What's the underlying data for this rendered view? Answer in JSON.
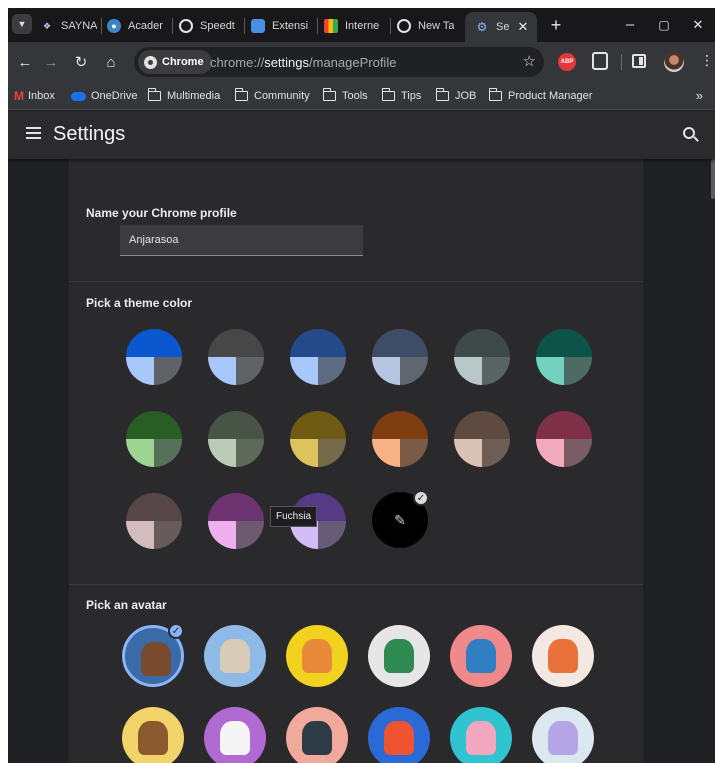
{
  "tabs": [
    {
      "label": "SAYNA",
      "favicon": "sayna-icon",
      "color": "#9aa0ff"
    },
    {
      "label": "Acader",
      "favicon": "academy-icon",
      "color": "#6cc4ff"
    },
    {
      "label": "Speedt",
      "favicon": "speedtest-icon",
      "color": "#e3e3e3"
    },
    {
      "label": "Extensi",
      "favicon": "extensions-icon",
      "color": "#4a90e2"
    },
    {
      "label": "Interne",
      "favicon": "internet-icon",
      "color": "#f2b300"
    },
    {
      "label": "New Ta",
      "favicon": "new-tab-icon",
      "color": "#e3e3e3"
    },
    {
      "label": "Se",
      "favicon": "settings-icon",
      "color": "#8ab4f8",
      "active": true
    }
  ],
  "toolbar": {
    "chip_label": "Chrome",
    "url_prefix": "chrome://",
    "url_host": "settings",
    "url_path": "/manageProfile",
    "abp_label": "ABP"
  },
  "bookmarks": [
    {
      "label": "Inbox",
      "icon": "gmail-icon"
    },
    {
      "label": "OneDrive",
      "icon": "onedrive-icon"
    },
    {
      "label": "Multimedia",
      "icon": "folder-icon"
    },
    {
      "label": "Community",
      "icon": "folder-icon"
    },
    {
      "label": "Tools",
      "icon": "folder-icon"
    },
    {
      "label": "Tips",
      "icon": "folder-icon"
    },
    {
      "label": "JOB",
      "icon": "folder-icon"
    },
    {
      "label": "Product Manager",
      "icon": "folder-icon"
    }
  ],
  "settings": {
    "title": "Settings",
    "name_section_title": "Name your Chrome profile",
    "profile_name": "Anjarasoa",
    "theme_section_title": "Pick a theme color",
    "tooltip": "Fuchsia",
    "avatar_section_title": "Pick an avatar"
  },
  "themes": [
    {
      "top": "#0b57d0",
      "bl": "#a8c7fa",
      "br": "#5f6368"
    },
    {
      "top": "#474747",
      "bl": "#a8c7fa",
      "br": "#5f6368"
    },
    {
      "top": "#254a8a",
      "bl": "#a8c7fa",
      "br": "#5e6a80"
    },
    {
      "top": "#3f4c66",
      "bl": "#b5c4e0",
      "br": "#5f6670"
    },
    {
      "top": "#3e4a4a",
      "bl": "#b8c8c8",
      "br": "#5a6464"
    },
    {
      "top": "#0d5347",
      "bl": "#72d2bf",
      "br": "#4e6a64"
    },
    {
      "top": "#285d23",
      "bl": "#9ed491",
      "br": "#56705a"
    },
    {
      "top": "#485445",
      "bl": "#bccbb7",
      "br": "#5d6a5a"
    },
    {
      "top": "#6e5a12",
      "bl": "#dec35c",
      "br": "#76694a"
    },
    {
      "top": "#7f3d10",
      "bl": "#f8b184",
      "br": "#7a5b47"
    },
    {
      "top": "#5e4a3e",
      "bl": "#dac3b4",
      "br": "#6e5f56"
    },
    {
      "top": "#7e3049",
      "bl": "#f4aabd",
      "br": "#7a5c65"
    },
    {
      "top": "#574647",
      "bl": "#d3bcbd",
      "br": "#675b5c"
    },
    {
      "top": "#6d3270",
      "bl": "#eeb0ee",
      "br": "#6e5a70"
    },
    {
      "top": "#573a86",
      "bl": "#d4bcf6",
      "br": "#665c78"
    }
  ],
  "avatars": [
    {
      "name": "profile-photo-avatar",
      "bg": "#3b6aa8",
      "fg": "#7a4a2e",
      "selected": true
    },
    {
      "name": "origami-cat-avatar",
      "bg": "#8fb9e6",
      "fg": "#d8cbb8"
    },
    {
      "name": "origami-corgi-avatar",
      "bg": "#f2d11f",
      "fg": "#e88a3a"
    },
    {
      "name": "origami-dragon-avatar",
      "bg": "#e6e6e6",
      "fg": "#2f8a52"
    },
    {
      "name": "origami-elephant-avatar",
      "bg": "#f08a8a",
      "fg": "#2f7fc2"
    },
    {
      "name": "origami-fox-avatar",
      "bg": "#f4e8e2",
      "fg": "#e8723a"
    },
    {
      "name": "origami-monkey-avatar",
      "bg": "#f2d46a",
      "fg": "#8a5a2e"
    },
    {
      "name": "origami-panda-avatar",
      "bg": "#b06ad2",
      "fg": "#f5f5f5"
    },
    {
      "name": "origami-penguin-avatar",
      "bg": "#f0a99a",
      "fg": "#2d3a48"
    },
    {
      "name": "origami-butterfly-avatar",
      "bg": "#2a6ad6",
      "fg": "#f0532f"
    },
    {
      "name": "origami-rabbit-avatar",
      "bg": "#2fc4cf",
      "fg": "#f2a6c0"
    },
    {
      "name": "origami-unicorn-avatar",
      "bg": "#dce8f0",
      "fg": "#b4a5e6"
    }
  ]
}
